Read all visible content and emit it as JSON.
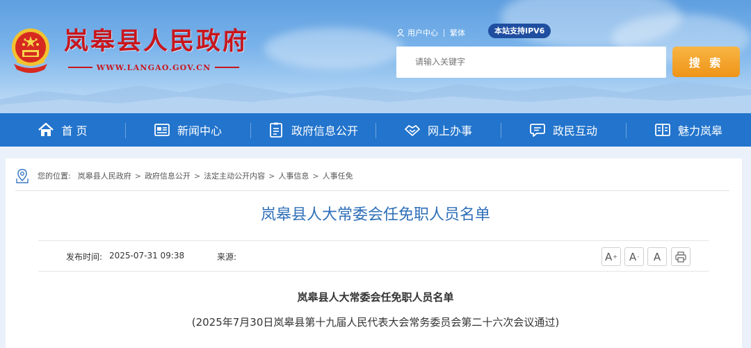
{
  "header": {
    "site_title": "岚皋县人民政府",
    "site_url": "WWW.LANGAO.GOV.CN",
    "user_center": "用户中心",
    "traditional": "繁体",
    "ipv6_badge": "本站支持IPV6",
    "search_placeholder": "请输入关键字",
    "search_button": "搜 索"
  },
  "nav": {
    "items": [
      {
        "label": "首 页",
        "icon": "home-icon"
      },
      {
        "label": "新闻中心",
        "icon": "newspaper-icon"
      },
      {
        "label": "政府信息公开",
        "icon": "document-list-icon"
      },
      {
        "label": "网上办事",
        "icon": "handshake-icon"
      },
      {
        "label": "政民互动",
        "icon": "chat-icon"
      },
      {
        "label": "魅力岚皋",
        "icon": "book-icon"
      }
    ]
  },
  "breadcrumb": {
    "prefix": "您的位置:",
    "items": [
      "岚皋县人民政府",
      "政府信息公开",
      "法定主动公开内容",
      "人事信息",
      "人事任免"
    ],
    "separator": ">"
  },
  "article": {
    "title": "岚皋县人大常委会任免职人员名单",
    "publish_label": "发布时间:",
    "publish_time": "2025-07-31 09:38",
    "source_label": "来源:",
    "source_value": "",
    "font_larger": "A",
    "font_smaller": "A",
    "font_default": "A",
    "doc_heading": "岚皋县人大常委会任免职人员名单",
    "doc_subheading": "(2025年7月30日岚皋县第十九届人民代表大会常务委员会第二十六次会议通过)"
  },
  "colors": {
    "brand_red": "#c8161d",
    "nav_blue": "#2274cc",
    "title_blue": "#2f6fb8",
    "search_orange": "#ee9418"
  }
}
